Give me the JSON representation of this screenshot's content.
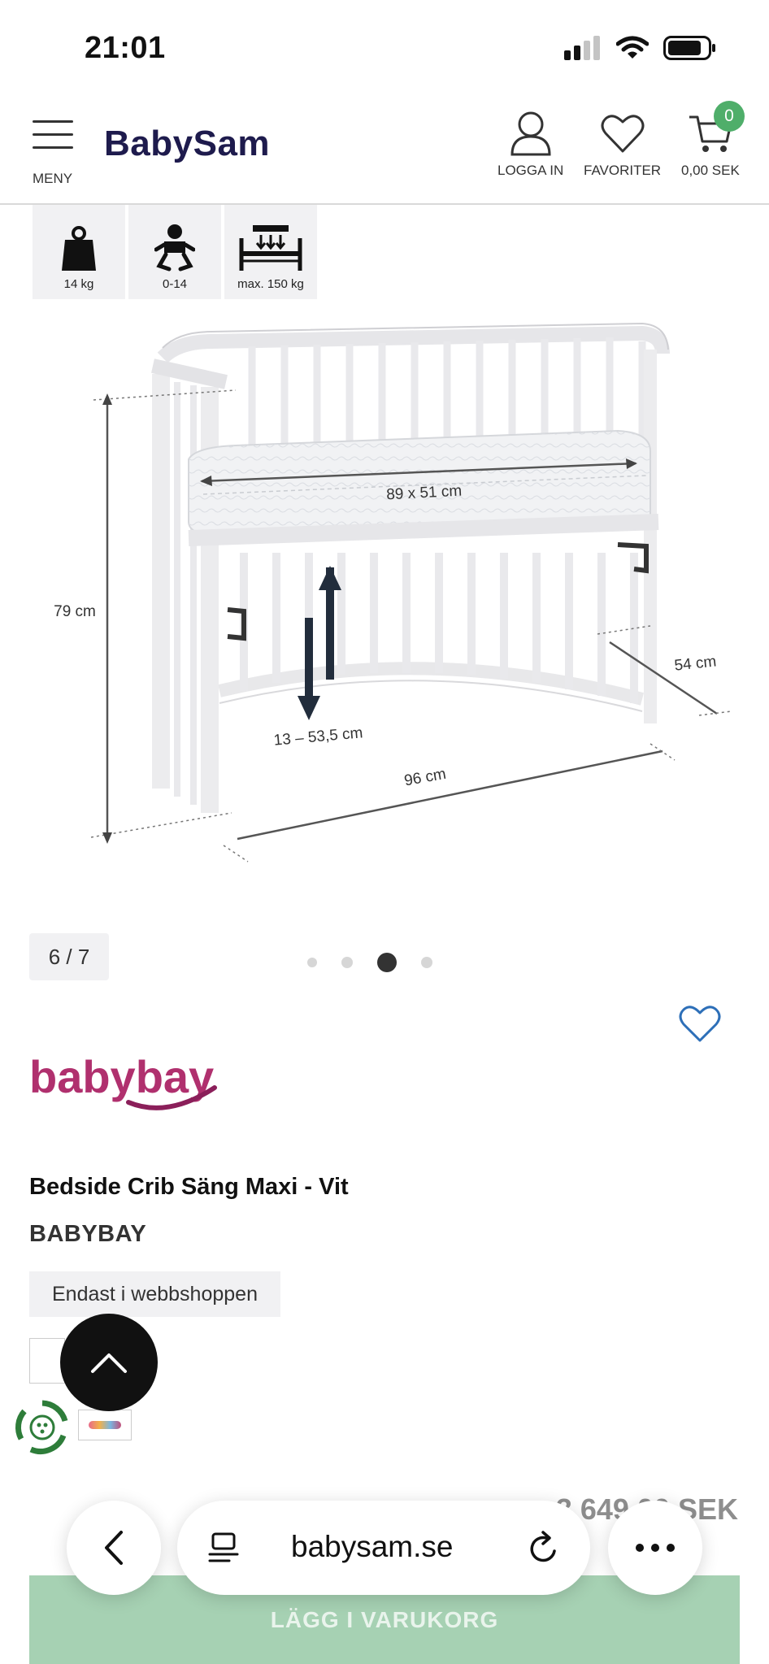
{
  "status_bar": {
    "time": "21:01"
  },
  "header": {
    "menu_label": "MENY",
    "logo": "BabySam",
    "login_label": "LOGGA IN",
    "favorites_label": "FAVORITER",
    "cart_total": "0,00 SEK",
    "cart_count": "0"
  },
  "features": [
    {
      "icon": "weight-icon",
      "label": "14 kg"
    },
    {
      "icon": "baby-icon",
      "label": "0-14"
    },
    {
      "icon": "bed-load-icon",
      "label": "max. 150 kg"
    }
  ],
  "image_labels": {
    "mattress": "89 x 51 cm",
    "height": "79 cm",
    "adjust": "13 – 53,5 cm",
    "width": "96 cm",
    "depth": "54 cm"
  },
  "gallery": {
    "counter": "6 / 7"
  },
  "product": {
    "brand_logo": "babybay",
    "title": "Bedside Crib Säng Maxi - Vit",
    "brand": "BABYBAY",
    "tag": "Endast i webbshoppen",
    "price": "3 649,00 SEK",
    "add_to_cart": "LÄGG I VARUKORG"
  },
  "browser": {
    "url": "babysam.se"
  },
  "colors": {
    "accent_green": "#4fae6a",
    "brand_navy": "#1e1b4d",
    "babybay_magenta": "#b0306e"
  }
}
